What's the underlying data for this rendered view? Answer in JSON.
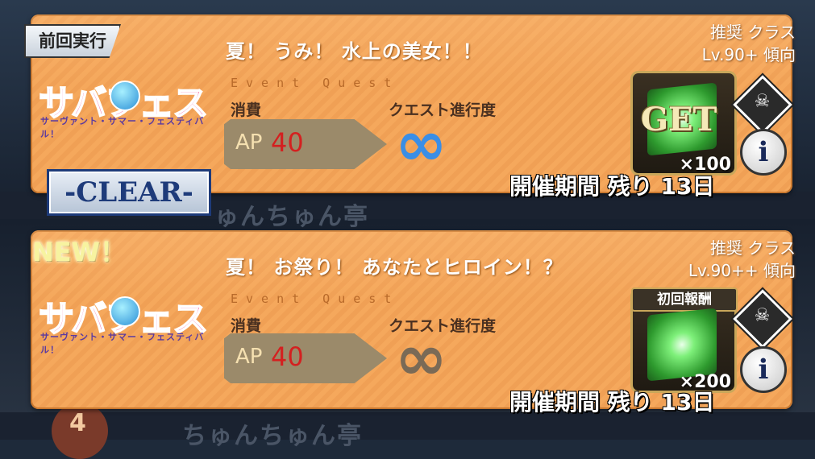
{
  "cards": [
    {
      "status_tag": "前回実行",
      "badge": "-CLEAR-",
      "logo_text": "サバフェス",
      "logo_sub": "サーヴァント・サマー・フェスティバル！",
      "title": "夏！ うみ！ 水上の美女！！",
      "event_label": "Event Quest",
      "cost_label": "消費",
      "ap_label": "AP",
      "ap_value": "40",
      "progress_label": "クエスト進行度",
      "progress_symbol": "∞",
      "progress_color": "#3a8ee6",
      "recommend_label": "推奨 クラス",
      "recommend_level": "Lv.90+ 傾向",
      "reward_overlay": "GET",
      "reward_qty": "×100",
      "period_text": "開催期間 残り 13日",
      "class_icon": "class-assassin-icon",
      "info_label": "i"
    },
    {
      "status_tag": "NEW！",
      "logo_text": "サバフェス",
      "logo_sub": "サーヴァント・サマー・フェスティバル！",
      "title": "夏！ お祭り！ あなたとヒロイン！？",
      "event_label": "Event Quest",
      "cost_label": "消費",
      "ap_label": "AP",
      "ap_value": "40",
      "progress_label": "クエスト進行度",
      "progress_symbol": "∞",
      "progress_color": "#7a6a56",
      "recommend_label": "推奨 クラス",
      "recommend_level": "Lv.90++ 傾向",
      "reward_header": "初回報酬",
      "reward_qty": "×200",
      "period_text": "開催期間 残り 13日",
      "class_icon": "class-skull-icon",
      "info_label": "i"
    }
  ],
  "background": {
    "label_1": "ゅんちゅん亭",
    "label_2": "ちゅんちゅん亭",
    "node_number": "4"
  }
}
